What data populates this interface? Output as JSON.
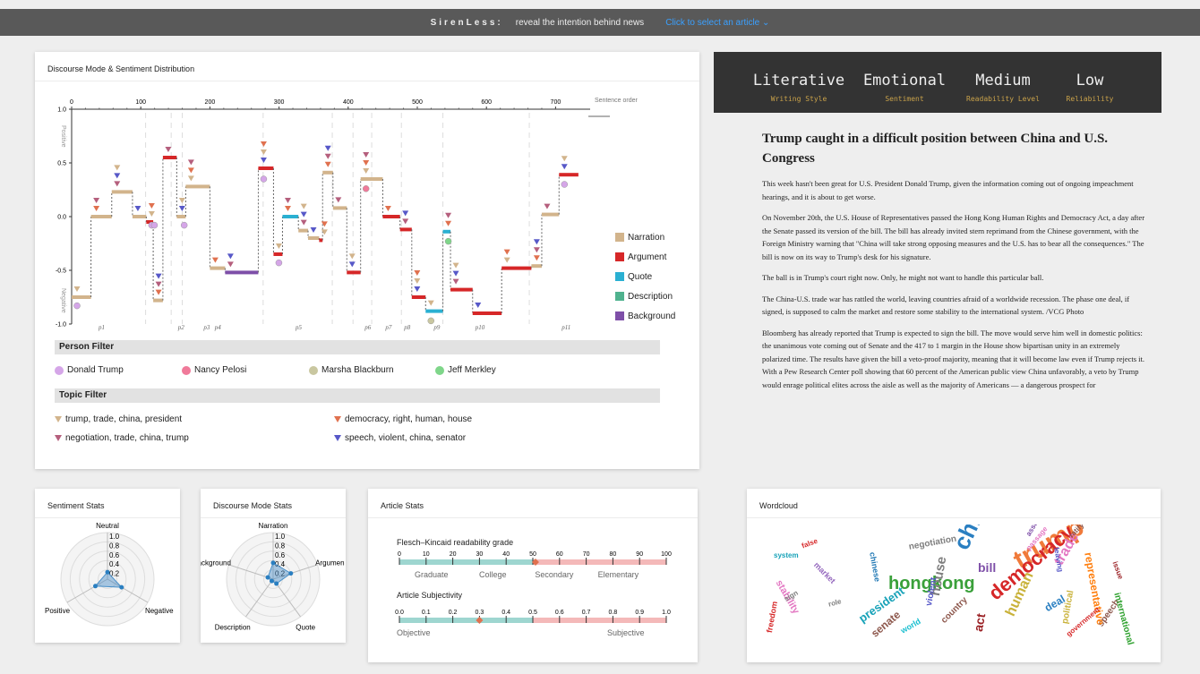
{
  "topbar": {
    "brand": "SirenLess:",
    "tagline": "reveal the intention behind news",
    "select_link": "Click to select an article ⌄"
  },
  "discourse_panel": {
    "title": "Discourse Mode & Sentiment Distribution",
    "x_axis_label": "Sentence order",
    "y_axis_top_label": "Positive",
    "y_axis_bottom_label": "Negative",
    "x_ticks": [
      "0",
      "100",
      "200",
      "300",
      "400",
      "500",
      "600",
      "700"
    ],
    "y_ticks": [
      "1.0",
      "0.5",
      "0.0",
      "-0.5",
      "-1.0"
    ],
    "paragraph_labels": [
      "p1",
      "p2",
      "p3",
      "p4",
      "p5",
      "p6",
      "p7",
      "p8",
      "p9",
      "p10",
      "p11"
    ],
    "legend": [
      {
        "label": "Narration",
        "color": "#d2b48c"
      },
      {
        "label": "Argument",
        "color": "#d62728"
      },
      {
        "label": "Quote",
        "color": "#2ab0d2"
      },
      {
        "label": "Description",
        "color": "#4fb28e"
      },
      {
        "label": "Background",
        "color": "#7e4fa8"
      }
    ]
  },
  "chart_data": [
    {
      "type": "line",
      "title": "Discourse Mode & Sentiment Distribution",
      "xlabel": "Sentence order",
      "ylabel": "",
      "xlim": [
        0,
        750
      ],
      "ylim": [
        -1.0,
        1.0
      ],
      "segments": [
        {
          "x0": 0,
          "x1": 28,
          "y": -0.75,
          "mode": "Narration"
        },
        {
          "x0": 28,
          "x1": 58,
          "y": 0.0,
          "mode": "Narration"
        },
        {
          "x0": 58,
          "x1": 88,
          "y": 0.23,
          "mode": "Narration"
        },
        {
          "x0": 88,
          "x1": 108,
          "y": 0.0,
          "mode": "Narration"
        },
        {
          "x0": 108,
          "x1": 118,
          "y": -0.05,
          "mode": "Argument"
        },
        {
          "x0": 118,
          "x1": 132,
          "y": -0.78,
          "mode": "Narration"
        },
        {
          "x0": 132,
          "x1": 152,
          "y": 0.55,
          "mode": "Argument"
        },
        {
          "x0": 152,
          "x1": 165,
          "y": 0.0,
          "mode": "Narration"
        },
        {
          "x0": 165,
          "x1": 200,
          "y": 0.28,
          "mode": "Narration"
        },
        {
          "x0": 200,
          "x1": 222,
          "y": -0.48,
          "mode": "Narration"
        },
        {
          "x0": 222,
          "x1": 270,
          "y": -0.52,
          "mode": "Background"
        },
        {
          "x0": 270,
          "x1": 292,
          "y": 0.45,
          "mode": "Argument"
        },
        {
          "x0": 292,
          "x1": 305,
          "y": -0.35,
          "mode": "Argument"
        },
        {
          "x0": 305,
          "x1": 328,
          "y": 0.0,
          "mode": "Quote"
        },
        {
          "x0": 328,
          "x1": 342,
          "y": -0.13,
          "mode": "Narration"
        },
        {
          "x0": 342,
          "x1": 358,
          "y": -0.2,
          "mode": "Narration"
        },
        {
          "x0": 358,
          "x1": 363,
          "y": -0.22,
          "mode": "Argument"
        },
        {
          "x0": 363,
          "x1": 378,
          "y": 0.41,
          "mode": "Narration"
        },
        {
          "x0": 378,
          "x1": 398,
          "y": 0.08,
          "mode": "Narration"
        },
        {
          "x0": 398,
          "x1": 418,
          "y": -0.52,
          "mode": "Argument"
        },
        {
          "x0": 418,
          "x1": 450,
          "y": 0.35,
          "mode": "Narration"
        },
        {
          "x0": 450,
          "x1": 475,
          "y": 0.0,
          "mode": "Argument"
        },
        {
          "x0": 475,
          "x1": 492,
          "y": -0.12,
          "mode": "Argument"
        },
        {
          "x0": 492,
          "x1": 512,
          "y": -0.75,
          "mode": "Argument"
        },
        {
          "x0": 512,
          "x1": 537,
          "y": -0.88,
          "mode": "Quote"
        },
        {
          "x0": 537,
          "x1": 548,
          "y": -0.14,
          "mode": "Quote"
        },
        {
          "x0": 548,
          "x1": 580,
          "y": -0.68,
          "mode": "Argument"
        },
        {
          "x0": 580,
          "x1": 622,
          "y": -0.9,
          "mode": "Argument"
        },
        {
          "x0": 622,
          "x1": 665,
          "y": -0.48,
          "mode": "Argument"
        },
        {
          "x0": 665,
          "x1": 680,
          "y": -0.46,
          "mode": "Narration"
        },
        {
          "x0": 680,
          "x1": 705,
          "y": 0.02,
          "mode": "Narration"
        },
        {
          "x0": 705,
          "x1": 733,
          "y": 0.39,
          "mode": "Argument"
        }
      ]
    },
    {
      "type": "radar",
      "title": "Sentiment Stats",
      "axes": [
        "Neutral",
        "Negative",
        "Positive"
      ],
      "values": [
        0.15,
        0.35,
        0.3
      ],
      "rlim": [
        0,
        1.0
      ]
    },
    {
      "type": "radar",
      "title": "Discourse Mode Stats",
      "axes": [
        "Narration",
        "Argumen",
        "Quote",
        "Description",
        "ackground"
      ],
      "values": [
        0.35,
        0.4,
        0.12,
        0.05,
        0.12
      ],
      "rlim": [
        0,
        1.0
      ]
    }
  ],
  "person_filter": {
    "title": "Person Filter",
    "persons": [
      {
        "name": "Donald Trump",
        "color": "#d5a6e8"
      },
      {
        "name": "Nancy Pelosi",
        "color": "#f07a9a"
      },
      {
        "name": "Marsha Blackburn",
        "color": "#c9c7a0"
      },
      {
        "name": "Jeff Merkley",
        "color": "#7fd68a"
      }
    ]
  },
  "topic_filter": {
    "title": "Topic Filter",
    "topics": [
      {
        "label": "trump, trade, china, president",
        "color": "#d2b48c"
      },
      {
        "label": "democracy, right, human, house",
        "color": "#e0714f"
      },
      {
        "label": "negotiation, trade, china, trump",
        "color": "#b55f7d"
      },
      {
        "label": "speech, violent, china, senator",
        "color": "#5758c8"
      }
    ]
  },
  "style_header": {
    "items": [
      {
        "value": "Literative",
        "label": "Writing Style"
      },
      {
        "value": "Emotional",
        "label": "Sentiment"
      },
      {
        "value": "Medium",
        "label": "Readability Level"
      },
      {
        "value": "Low",
        "label": "Reliability"
      }
    ]
  },
  "article": {
    "title": "Trump caught in a difficult position between China and U.S. Congress",
    "paragraphs": [
      "This week hasn't been great for U.S. President Donald Trump, given the information coming out of ongoing impeachment hearings, and it is about to get worse.",
      "On November 20th, the U.S. House of Representatives passed the Hong Kong Human Rights and Democracy Act, a day after the Senate passed its version of the bill. The bill has already invited stern reprimand from the Chinese government, with the Foreign Ministry warning that \"China will take strong opposing measures and the U.S. has to bear all the consequences.\" The bill is now on its way to Trump's desk for his signature.",
      "The ball is in Trump's court right now. Only, he might not want to handle this particular ball.",
      "The China-U.S. trade war has rattled the world, leaving countries afraid of a worldwide recession. The phase one deal, if signed, is supposed to calm the market and restore some stability to the international system. /VCG Photo",
      "Bloomberg has already reported that Trump is expected to sign the bill. The move would serve him well in domestic politics: the unanimous vote coming out of Senate and the 417 to 1 margin in the House show bipartisan unity in an extremely polarized time. The results have given the bill a veto-proof majority, meaning that it will become law even if Trump rejects it. With a Pew Research Center poll showing that 60 percent of the American public view China unfavorably, a veto by Trump would enrage political elites across the aisle as well as the majority of Americans — a dangerous prospect for"
    ]
  },
  "sentiment_stats": {
    "title": "Sentiment Stats",
    "ticks": [
      "1.0",
      "0.8",
      "0.6",
      "0.4",
      "0.2"
    ],
    "axis_labels": [
      "Neutral",
      "Negative",
      "Positive"
    ]
  },
  "discourse_stats": {
    "title": "Discourse Mode Stats",
    "ticks": [
      "1.0",
      "0.8",
      "0.6",
      "0.4",
      "0.2"
    ],
    "axis_labels": [
      "Narration",
      "Argumen",
      "Quote",
      "Description",
      "ackground"
    ]
  },
  "article_stats": {
    "title": "Article Stats",
    "readability": {
      "label": "Flesch–Kincaid readability grade",
      "ticks": [
        "0",
        "10",
        "20",
        "30",
        "40",
        "50",
        "60",
        "70",
        "80",
        "90",
        "100"
      ],
      "bands": [
        "Graduate",
        "College",
        "Secondary",
        "Elementary"
      ],
      "value": 51
    },
    "subjectivity": {
      "label": "Article Subjectivity",
      "ticks": [
        "0.0",
        "0.1",
        "0.2",
        "0.3",
        "0.4",
        "0.5",
        "0.6",
        "0.7",
        "0.8",
        "0.9",
        "1.0"
      ],
      "ends": [
        "Objective",
        "Subjective"
      ],
      "value": 0.3
    }
  },
  "wordcloud": {
    "title": "Wordcloud",
    "words": [
      {
        "text": "china",
        "color": "#2a7fc1"
      },
      {
        "text": "trump",
        "color": "#f07a3a"
      },
      {
        "text": "hongkong",
        "color": "#3aa03a"
      },
      {
        "text": "democracy",
        "color": "#d62728"
      },
      {
        "text": "human",
        "color": "#c9b23a"
      },
      {
        "text": "bill",
        "color": "#7e4fa8"
      },
      {
        "text": "trade",
        "color": "#e377c2"
      },
      {
        "text": "house",
        "color": "#7f7f7f"
      },
      {
        "text": "president",
        "color": "#17a2b8"
      },
      {
        "text": "senate",
        "color": "#8c564b"
      },
      {
        "text": "deal",
        "color": "#2a7fc1"
      },
      {
        "text": "act",
        "color": "#9b2226"
      },
      {
        "text": "violent",
        "color": "#5758c8"
      },
      {
        "text": "negotiation",
        "color": "#7f7f7f"
      },
      {
        "text": "speech",
        "color": "#8c564b"
      },
      {
        "text": "freedom",
        "color": "#d62728"
      },
      {
        "text": "stability",
        "color": "#e377c2"
      },
      {
        "text": "world",
        "color": "#17becf"
      },
      {
        "text": "country",
        "color": "#8c564b"
      },
      {
        "text": "political",
        "color": "#c9b23a"
      },
      {
        "text": "market",
        "color": "#9467bd"
      },
      {
        "text": "chinese",
        "color": "#1f77b4"
      },
      {
        "text": "international",
        "color": "#2ca02c"
      },
      {
        "text": "representative",
        "color": "#ff7f0e"
      },
      {
        "text": "government",
        "color": "#d62728"
      },
      {
        "text": "issue",
        "color": "#9b2226"
      },
      {
        "text": "leaving",
        "color": "#5758c8"
      },
      {
        "text": "passage",
        "color": "#e377c2"
      },
      {
        "text": "ratify",
        "color": "#8c564b"
      },
      {
        "text": "assumption",
        "color": "#7e4fa8"
      },
      {
        "text": "sign",
        "color": "#7f7f7f"
      },
      {
        "text": "false",
        "color": "#d62728"
      },
      {
        "text": "system",
        "color": "#17a2b8"
      },
      {
        "text": "role",
        "color": "#7f7f7f"
      }
    ]
  }
}
